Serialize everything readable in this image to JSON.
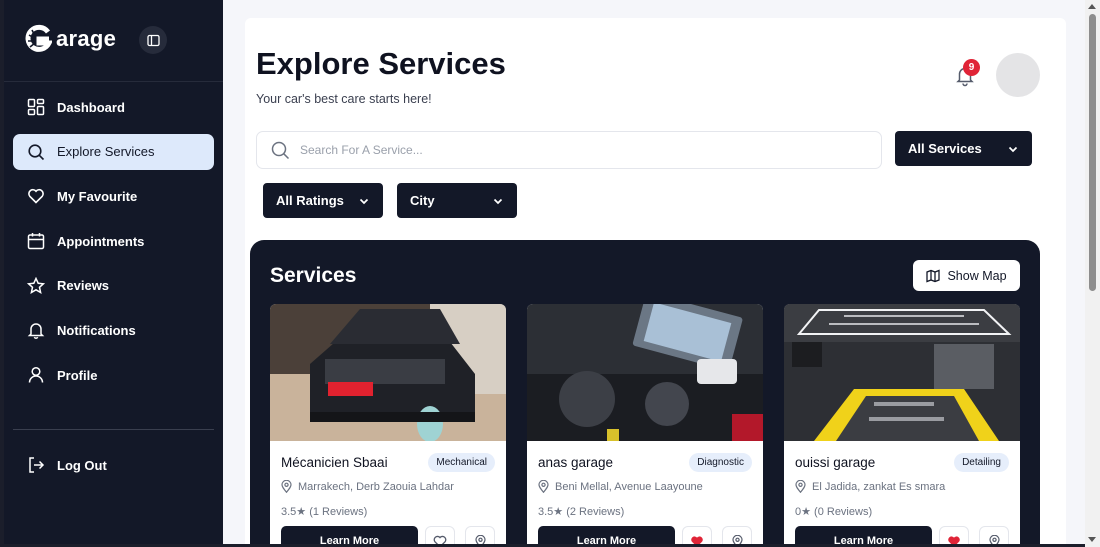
{
  "brand": {
    "name": "arage"
  },
  "sidebar": {
    "items": [
      {
        "label": "Dashboard",
        "icon": "dashboard-icon"
      },
      {
        "label": "Explore Services",
        "icon": "search-icon",
        "active": true
      },
      {
        "label": "My Favourite",
        "icon": "heart-icon"
      },
      {
        "label": "Appointments",
        "icon": "calendar-icon"
      },
      {
        "label": "Reviews",
        "icon": "star-icon"
      },
      {
        "label": "Notifications",
        "icon": "bell-icon"
      },
      {
        "label": "Profile",
        "icon": "user-icon"
      }
    ],
    "logout_label": "Log Out"
  },
  "header": {
    "title": "Explore Services",
    "subtitle": "Your car's best care starts here!",
    "notification_count": "9"
  },
  "filters": {
    "search_placeholder": "Search For A Service...",
    "service_select": "All Services",
    "rating_select": "All Ratings",
    "city_select": "City"
  },
  "services": {
    "title": "Services",
    "show_map_label": "Show Map",
    "cards": [
      {
        "name": "Mécanicien Sbaai",
        "tag": "Mechanical",
        "location": "Marrakech, Derb Zaouia Lahdar",
        "rating": "3.5★ (1 Reviews)",
        "button": "Learn More",
        "favourite": false
      },
      {
        "name": "anas garage",
        "tag": "Diagnostic",
        "location": "Beni Mellal, Avenue Laayoune",
        "rating": "3.5★ (2 Reviews)",
        "button": "Learn More",
        "favourite": true
      },
      {
        "name": "ouissi garage",
        "tag": "Detailing",
        "location": "El Jadida, zankat Es smara",
        "rating": "0★ (0 Reviews)",
        "button": "Learn More",
        "favourite": true
      }
    ]
  },
  "colors": {
    "sidebar_bg": "#131828",
    "active_bg": "#dde9fb",
    "badge": "#e02437",
    "favourite": "#e02437"
  }
}
